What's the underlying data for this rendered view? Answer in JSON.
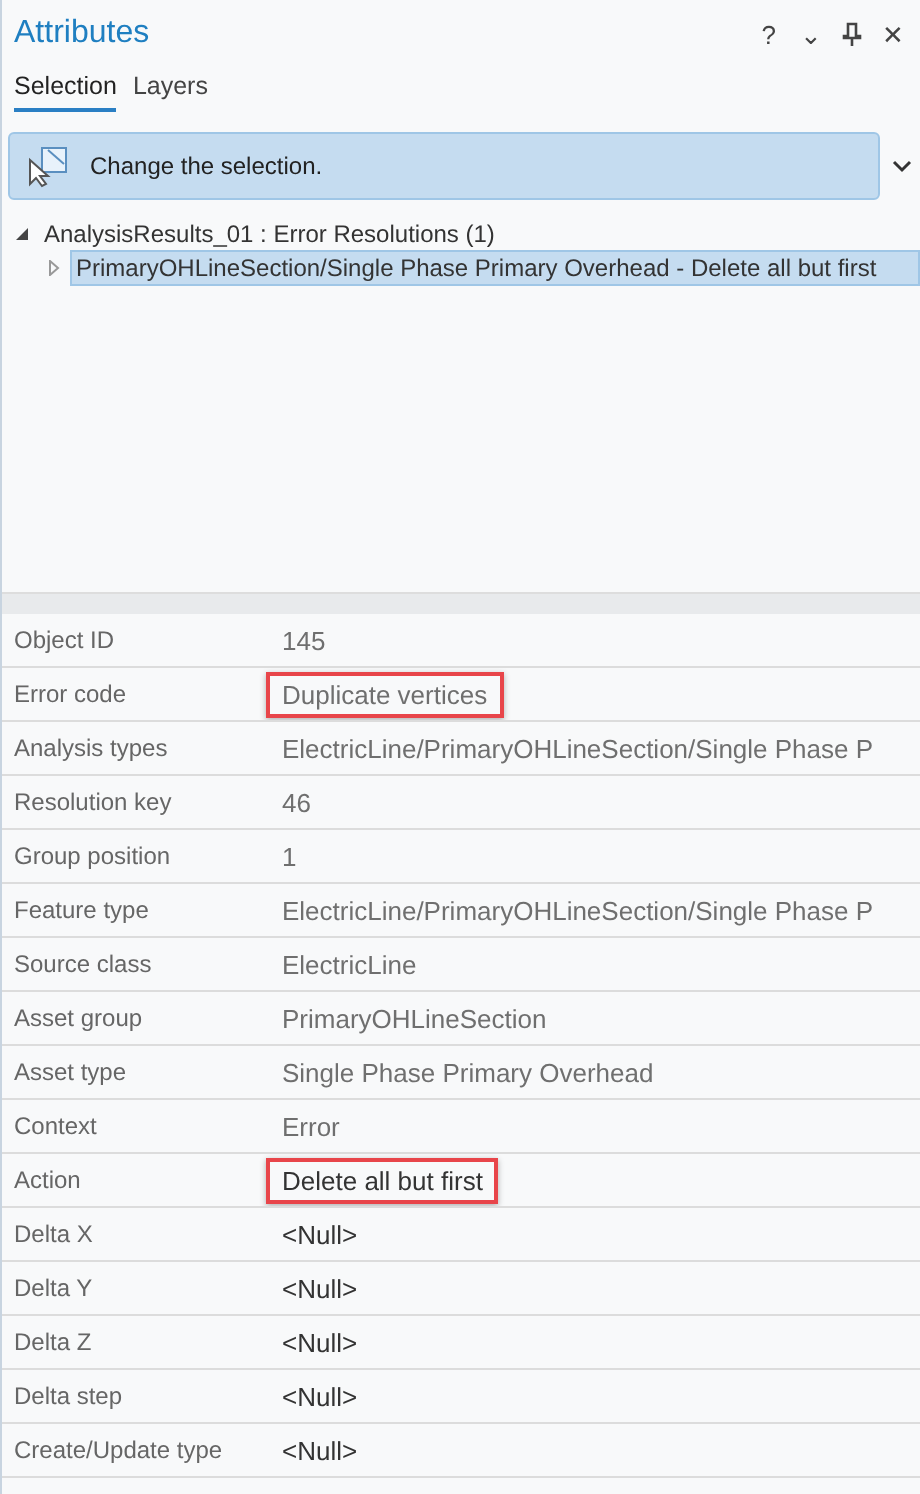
{
  "window": {
    "title": "Attributes",
    "controls": [
      "?",
      "⌄",
      "✕"
    ]
  },
  "tabs": [
    {
      "label": "Selection",
      "selected": true
    },
    {
      "label": "Layers",
      "selected": false
    }
  ],
  "banner": {
    "text": "Change the selection."
  },
  "tree": [
    {
      "label": "AnalysisResults_01 : Error Resolutions (1)",
      "expanded": true,
      "selected": false,
      "children": [
        {
          "label": "PrimaryOHLineSection/Single Phase Primary Overhead - Delete all but first",
          "expanded": false,
          "selected": true
        }
      ]
    }
  ],
  "attributes": [
    {
      "field": "Object ID",
      "value": "145",
      "editable": false,
      "highlighted": false
    },
    {
      "field": "Error code",
      "value": "Duplicate vertices",
      "editable": false,
      "highlighted": true
    },
    {
      "field": "Analysis types",
      "value": "ElectricLine/PrimaryOHLineSection/Single Phase P",
      "editable": false,
      "highlighted": false
    },
    {
      "field": "Resolution key",
      "value": "46",
      "editable": false,
      "highlighted": false
    },
    {
      "field": "Group position",
      "value": "1",
      "editable": false,
      "highlighted": false
    },
    {
      "field": "Feature type",
      "value": "ElectricLine/PrimaryOHLineSection/Single Phase P",
      "editable": false,
      "highlighted": false
    },
    {
      "field": "Source class",
      "value": "ElectricLine",
      "editable": false,
      "highlighted": false
    },
    {
      "field": "Asset group",
      "value": "PrimaryOHLineSection",
      "editable": false,
      "highlighted": false
    },
    {
      "field": "Asset type",
      "value": "Single Phase Primary Overhead",
      "editable": false,
      "highlighted": false
    },
    {
      "field": "Context",
      "value": "Error",
      "editable": false,
      "highlighted": false
    },
    {
      "field": "Action",
      "value": "Delete all but first",
      "editable": true,
      "highlighted": true
    },
    {
      "field": "Delta X",
      "value": "<Null>",
      "editable": true,
      "highlighted": false
    },
    {
      "field": "Delta Y",
      "value": "<Null>",
      "editable": true,
      "highlighted": false
    },
    {
      "field": "Delta Z",
      "value": "<Null>",
      "editable": true,
      "highlighted": false
    },
    {
      "field": "Delta step",
      "value": "<Null>",
      "editable": true,
      "highlighted": false
    },
    {
      "field": "Create/Update type",
      "value": "<Null>",
      "editable": true,
      "highlighted": false
    }
  ]
}
